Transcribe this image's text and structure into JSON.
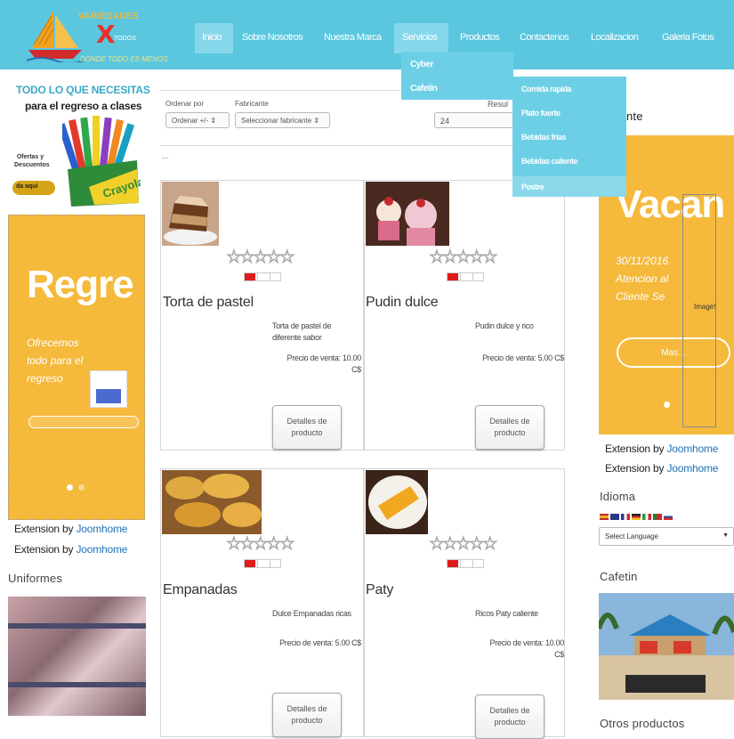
{
  "logo": {
    "line1": "VARIEDADES",
    "line2": "TODOS",
    "tagline": "DONDE TODO ES MENOS"
  },
  "nav": [
    "Inicio",
    "Sobre Nosotros",
    "Nuestra Marca",
    "Servicios",
    "Productos",
    "Contactenos",
    "Localizacion",
    "Galeria Fotos"
  ],
  "servicios_menu": [
    "Cyber",
    "Cafetin"
  ],
  "cafetin_menu": [
    "Comida rapida",
    "Plato fuerte",
    "Bebidas frias",
    "Bebidas caliente",
    "Postre"
  ],
  "left_ad": {
    "title": "TODO LO QUE NECESITAS",
    "subtitle": "para el regreso a clases",
    "ofertas": "Ofertas y Descuentos",
    "aqui": "da aqui",
    "brand": "Crayola"
  },
  "left_slider": {
    "headline": "Regre",
    "text": "Ofrecemos todo para el regreso"
  },
  "extension_by": "Extension by",
  "joomhome": "Joomhome",
  "uniformes": "Uniformes",
  "toolbar": {
    "ordenar_label": "Ordenar por",
    "ordenar_value": "Ordenar +/-",
    "fabricante_label": "Fabricante",
    "fabricante_value": "Seleccionar fabricante",
    "resultados_label": "Resul",
    "resultados_value": "24"
  },
  "dots": "...",
  "products": [
    {
      "name": "Torta de pastel",
      "desc": "Torta de pastel de diferente sabor",
      "price_label": "Precio de venta:",
      "price": "10.00 C$",
      "button": "Detalles de producto"
    },
    {
      "name": "Pudin dulce",
      "desc": "Pudin dulce y rico",
      "price_label": "Precio de venta:",
      "price": "5.00 C$",
      "button": "Detalles de producto"
    },
    {
      "name": "Empanadas",
      "desc": "Dulce Empanadas ricas",
      "price_label": "Precio de venta:",
      "price": "5.00 C$",
      "button": "Detalles de producto"
    },
    {
      "name": "Paty",
      "desc": "Ricos Paty caliente",
      "price_label": "Precio de venta:",
      "price": "10.00 C$",
      "button": "Detalles de producto"
    }
  ],
  "right": {
    "partial_heading": "nte",
    "slider_headline": "Vacan",
    "slider_date": "30/11/2016",
    "slider_text": "Atencion al Cliente Se",
    "image_label": "Image!",
    "mas_button": "Mas...",
    "idioma": "Idioma",
    "select_language": "Select Language",
    "cafetin": "Cafetin",
    "otros": "Otros productos"
  },
  "colors": {
    "header": "#5ac7df",
    "accent": "#3aa9c8",
    "banner": "#f5b93b",
    "link": "#1d72b8",
    "rating": "#e01b1b"
  }
}
